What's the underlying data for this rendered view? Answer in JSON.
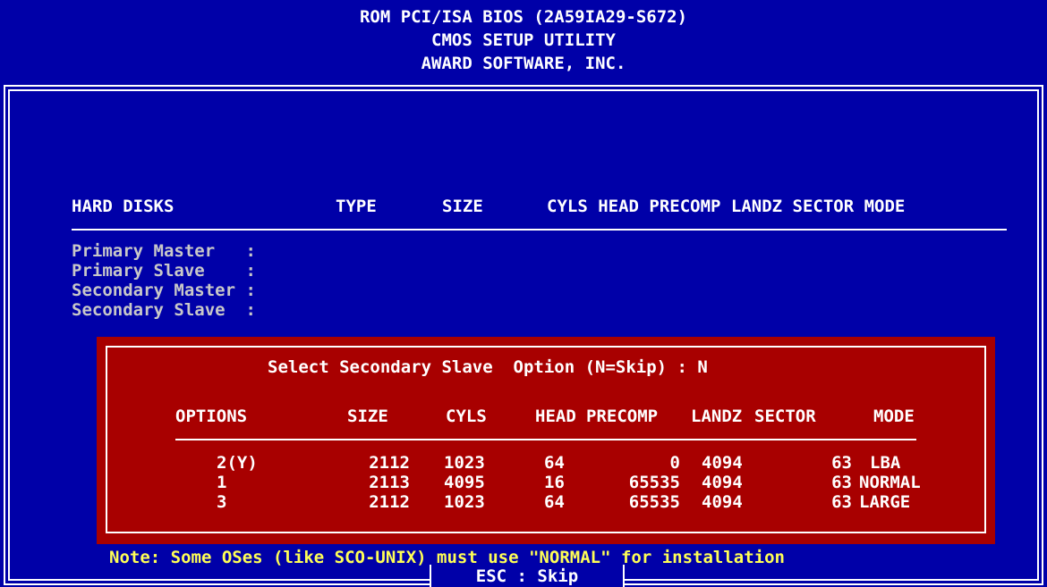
{
  "header": {
    "line1": "ROM PCI/ISA BIOS (2A59IA29-S672)",
    "line2": "CMOS SETUP UTILITY",
    "line3": "AWARD SOFTWARE, INC."
  },
  "table": {
    "headers": {
      "hard_disks": "HARD DISKS",
      "type": "TYPE",
      "size": "SIZE",
      "cyls_head_precomp": "CYLS HEAD PRECOMP LANDZ SECTOR MODE"
    },
    "rows": [
      {
        "label": "Primary Master   :"
      },
      {
        "label": "Primary Slave    :"
      },
      {
        "label": "Secondary Master :"
      },
      {
        "label": "Secondary Slave  :"
      }
    ]
  },
  "dialog": {
    "prompt": "Select Secondary Slave  Option (N=Skip) : N",
    "headers": {
      "options": "OPTIONS",
      "size": "SIZE",
      "cyls": "CYLS",
      "head": "HEAD",
      "precomp": "PRECOMP",
      "landz": "LANDZ",
      "sector": "SECTOR",
      "mode": "MODE"
    },
    "options": [
      {
        "option": "2(Y)",
        "size": "2112",
        "cyls": "1023",
        "head": "64",
        "precomp": "0",
        "landz": "4094",
        "sector": "63",
        "mode": "LBA"
      },
      {
        "option": "1",
        "size": "2113",
        "cyls": "4095",
        "head": "16",
        "precomp": "65535",
        "landz": "4094",
        "sector": "63",
        "mode": "NORMAL"
      },
      {
        "option": "3",
        "size": "2112",
        "cyls": "1023",
        "head": "64",
        "precomp": "65535",
        "landz": "4094",
        "sector": "63",
        "mode": "LARGE"
      }
    ]
  },
  "footer": {
    "note": "Note: Some OSes (like SCO-UNIX) must use \"NORMAL\" for installation",
    "esc_label": "ESC : Skip"
  },
  "colors": {
    "background": "#0000a8",
    "dialog": "#a80000",
    "note": "#ffff55"
  }
}
